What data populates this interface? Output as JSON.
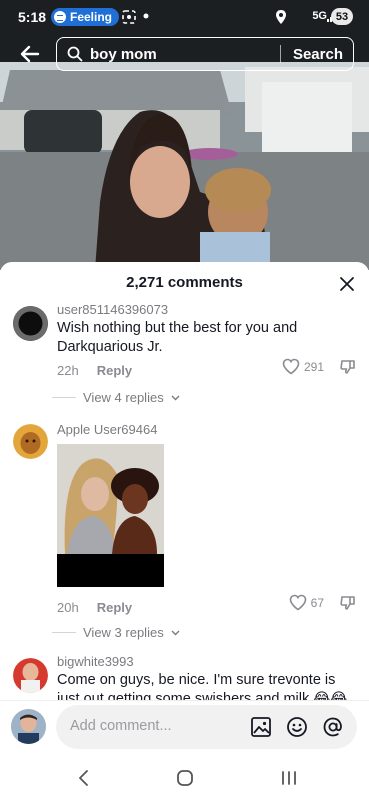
{
  "status": {
    "time": "5:18",
    "spotify_label": "Feeling",
    "network": "5G",
    "battery": "53"
  },
  "search": {
    "query": "boy mom",
    "button_label": "Search"
  },
  "comments_sheet": {
    "title": "2,271 comments",
    "comments": [
      {
        "username": "user851146396073",
        "text": "Wish nothing but the best for you and Darkquarious Jr.",
        "time": "22h",
        "reply_label": "Reply",
        "likes": "291",
        "view_replies": "View 4 replies"
      },
      {
        "username": "Apple User69464",
        "time": "20h",
        "reply_label": "Reply",
        "likes": "67",
        "view_replies": "View 3 replies"
      },
      {
        "username": "bigwhite3993",
        "text": "Come on guys, be nice. I'm sure trevonte is just out getting some swishers and milk 😂😂"
      }
    ]
  },
  "composer": {
    "placeholder": "Add comment..."
  },
  "colors": {
    "accent_blue": "#1f6fd6",
    "text_primary": "#161823",
    "text_secondary": "#8a8b91"
  },
  "icons": [
    "back-arrow-icon",
    "search-icon",
    "close-icon",
    "heart-icon",
    "dislike-icon",
    "chevron-down-icon",
    "image-icon",
    "emoji-icon",
    "mention-icon",
    "nav-back-icon",
    "nav-home-icon",
    "nav-recents-icon"
  ]
}
